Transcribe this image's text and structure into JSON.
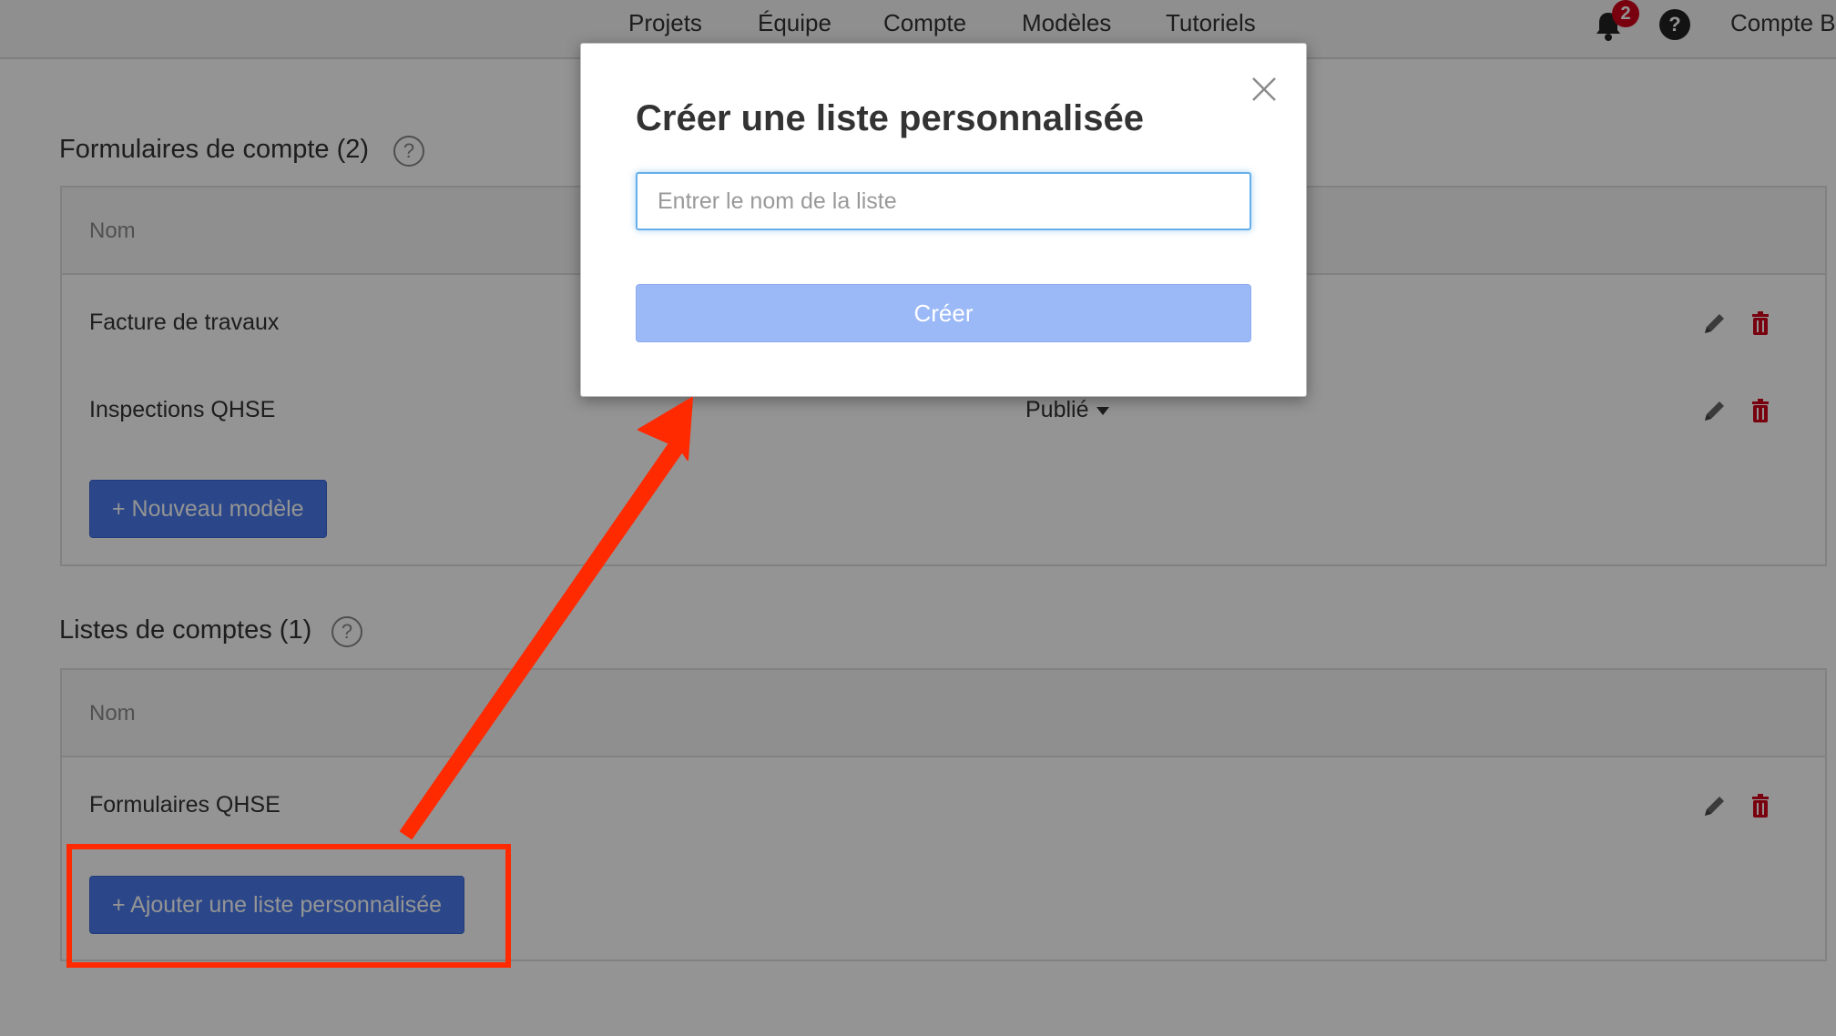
{
  "nav": {
    "items": [
      "Projets",
      "Équipe",
      "Compte",
      "Modèles",
      "Tutoriels"
    ],
    "notifications_count": "2",
    "help_label": "?",
    "account_label": "Compte B"
  },
  "forms_section": {
    "title": "Formulaires de compte (2)",
    "help_label": "?",
    "column_name": "Nom",
    "rows": [
      {
        "name": "Facture de travaux",
        "status": ""
      },
      {
        "name": "Inspections QHSE",
        "status": "Publié"
      }
    ],
    "new_button_label": "+ Nouveau modèle"
  },
  "lists_section": {
    "title": "Listes de comptes (1)",
    "help_label": "?",
    "column_name": "Nom",
    "rows": [
      {
        "name": "Formulaires QHSE"
      }
    ],
    "add_button_label": "+ Ajouter une liste personnalisée"
  },
  "modal": {
    "title": "Créer une liste personnalisée",
    "input_placeholder": "Entrer le nom de la liste",
    "input_value": "",
    "create_button_label": "Créer"
  },
  "colors": {
    "primary_button": "#4a7bec",
    "disabled_button": "#9bb8f7",
    "danger_icon": "#d0021b",
    "annotation": "#ff2a00",
    "input_focus": "#66afe9"
  },
  "icons": {
    "bell": "bell-icon",
    "help": "question-circle-icon",
    "edit": "pencil-icon",
    "delete": "trash-icon",
    "close": "close-icon",
    "dropdown": "caret-down-icon"
  }
}
